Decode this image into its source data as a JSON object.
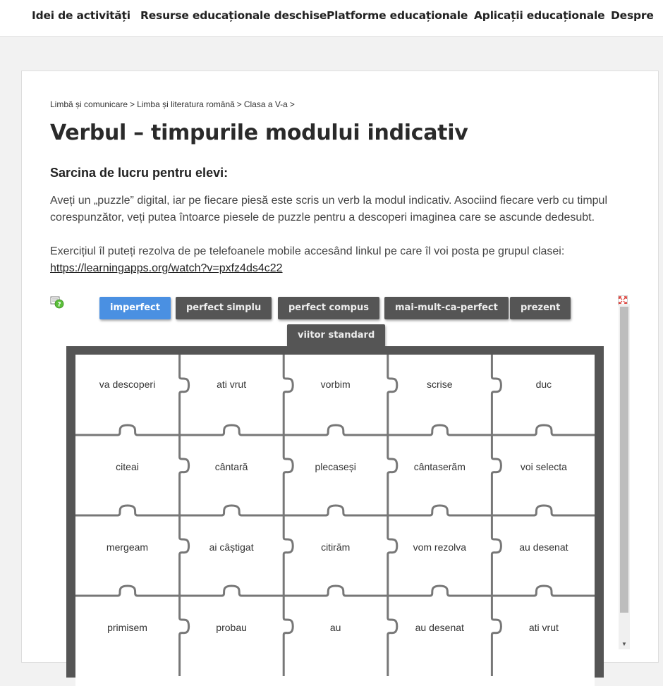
{
  "nav": {
    "items": [
      {
        "label": "Idei de activități"
      },
      {
        "label": "Resurse educaționale deschise"
      },
      {
        "label": "Platforme educaționale"
      },
      {
        "label": "Aplicații educaționale"
      },
      {
        "label": "Despre"
      }
    ]
  },
  "breadcrumb": {
    "items": [
      {
        "label": "Limbă și comunicare"
      },
      {
        "label": "Limba și literatura română"
      },
      {
        "label": "Clasa a V-a"
      }
    ],
    "separator": ">"
  },
  "page": {
    "title": "Verbul – timpurile modului indicativ",
    "subtitle": "Sarcina de lucru pentru elevi:",
    "paragraph1": "Aveți un „puzzle” digital, iar pe fiecare piesă este scris un verb la modul indicativ. Asociind fiecare verb cu timpul corespunzător, veți putea întoarce piesele de puzzle pentru a descoperi imaginea care se ascunde dedesubt.",
    "paragraph2": "Exercițiul îl puteți rezolva de pe telefoanele mobile accesând linkul pe care îl voi posta pe grupul clasei:",
    "link": "https://learningapps.org/watch?v=pxfz4ds4c22"
  },
  "app": {
    "help_icon": "help-question-icon",
    "fullscreen_icon": "fullscreen-icon",
    "categories": [
      {
        "label": "imperfect",
        "active": true
      },
      {
        "label": "perfect simplu",
        "active": false
      },
      {
        "label": "perfect compus",
        "active": false
      },
      {
        "label": "mai-mult-ca-perfect",
        "active": false
      },
      {
        "label": "prezent",
        "active": false
      },
      {
        "label": "viitor standard",
        "active": false
      }
    ],
    "pieces": [
      [
        "va descoperi",
        "ati vrut",
        "vorbim",
        "scrise",
        "duc"
      ],
      [
        "citeai",
        "cântară",
        "plecaseși",
        "cântaserăm",
        "voi selecta"
      ],
      [
        "mergeam",
        "ai câștigat",
        "citirăm",
        "vom rezolva",
        "au desenat"
      ],
      [
        "primisem",
        "probau",
        "au",
        "au desenat",
        "ati vrut"
      ]
    ]
  },
  "colors": {
    "active_button": "#4a90e2",
    "button": "#555555",
    "frame": "#555555"
  }
}
